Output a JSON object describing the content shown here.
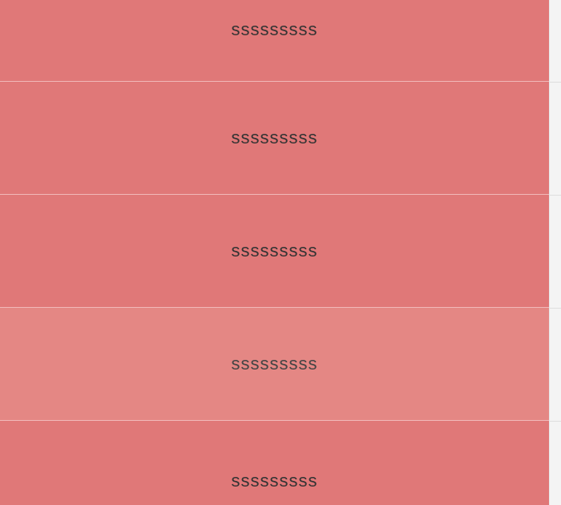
{
  "colors": {
    "item_background": "#e07878",
    "item_highlighted_background": "#e48784",
    "separator": "#f1b9b9",
    "text": "#333333",
    "page_background": "#f4f4f4"
  },
  "list": {
    "items": [
      {
        "label": "sssssssss",
        "highlighted": false
      },
      {
        "label": "sssssssss",
        "highlighted": false
      },
      {
        "label": "sssssssss",
        "highlighted": false
      },
      {
        "label": "sssssssss",
        "highlighted": true
      },
      {
        "label": "sssssssss",
        "highlighted": false
      }
    ]
  }
}
